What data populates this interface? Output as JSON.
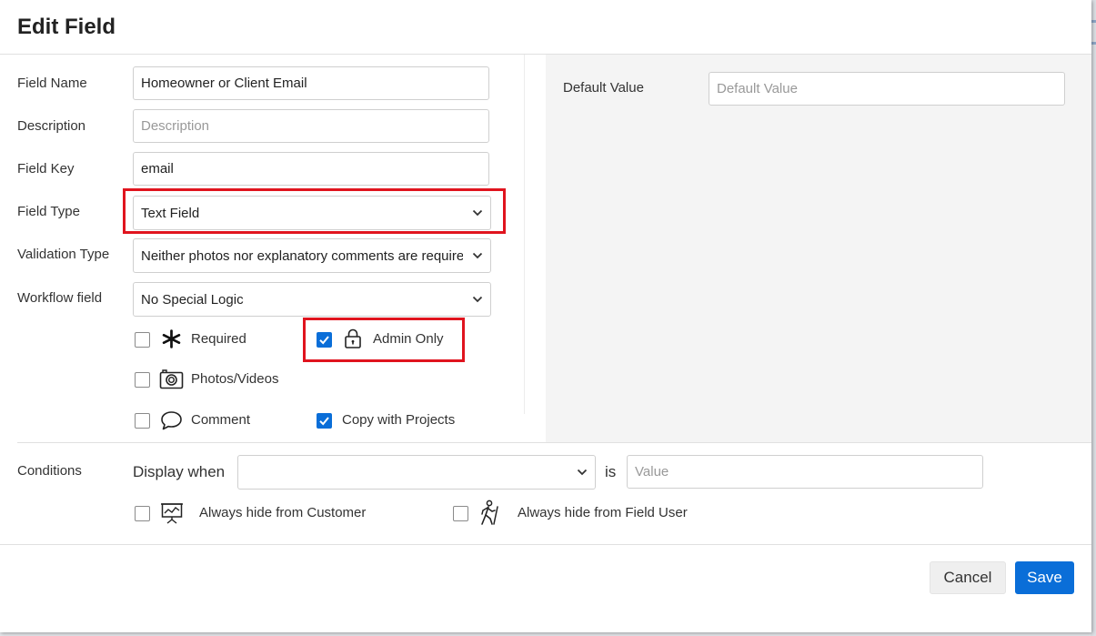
{
  "dialog": {
    "title": "Edit Field"
  },
  "form": {
    "field_name": {
      "label": "Field Name",
      "value": "Homeowner or Client Email"
    },
    "description": {
      "label": "Description",
      "value": "",
      "placeholder": "Description"
    },
    "field_key": {
      "label": "Field Key",
      "value": "email"
    },
    "field_type": {
      "label": "Field Type",
      "value": "Text Field"
    },
    "validation_type": {
      "label": "Validation Type",
      "value": "Neither photos nor explanatory comments are required"
    },
    "workflow_field": {
      "label": "Workflow field",
      "value": "No Special Logic"
    },
    "default_value": {
      "label": "Default Value",
      "value": "",
      "placeholder": "Default Value"
    }
  },
  "options": {
    "required": {
      "label": "Required",
      "checked": false,
      "icon": "asterisk-icon"
    },
    "admin_only": {
      "label": "Admin Only",
      "checked": true,
      "icon": "lock-icon"
    },
    "photos_videos": {
      "label": "Photos/Videos",
      "checked": false,
      "icon": "camera-icon"
    },
    "comment": {
      "label": "Comment",
      "checked": false,
      "icon": "speech-bubble-icon"
    },
    "copy_with_projects": {
      "label": "Copy with Projects",
      "checked": true
    }
  },
  "conditions": {
    "label": "Conditions",
    "display_when_label": "Display when",
    "display_when_value": "",
    "is_label": "is",
    "value_placeholder": "Value",
    "hide_from_customer": {
      "label": "Always hide from Customer",
      "checked": false,
      "icon": "presentation-chart-icon"
    },
    "hide_from_field_user": {
      "label": "Always hide from Field User",
      "checked": false,
      "icon": "walking-person-icon"
    }
  },
  "footer": {
    "cancel_label": "Cancel",
    "save_label": "Save"
  },
  "colors": {
    "accent": "#0a6ed8",
    "highlight": "#e0141e",
    "panel": "#f4f4f4"
  }
}
